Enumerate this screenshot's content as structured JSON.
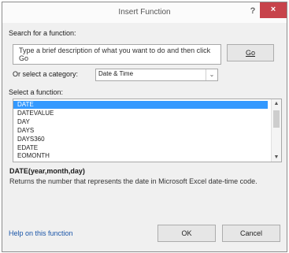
{
  "window": {
    "title": "Insert Function",
    "help_glyph": "?",
    "close_glyph": "×"
  },
  "search": {
    "label": "Search for a function:",
    "value": "Type a brief description of what you want to do and then click Go",
    "go_label": "Go"
  },
  "category": {
    "label": "Or select a category:",
    "selected": "Date & Time",
    "arrow_glyph": "⌄"
  },
  "function_list": {
    "label": "Select a function:",
    "items": [
      "DATE",
      "DATEVALUE",
      "DAY",
      "DAYS",
      "DAYS360",
      "EDATE",
      "EOMONTH"
    ],
    "selected": "DATE",
    "scroll_up": "▲",
    "scroll_down": "▼"
  },
  "details": {
    "syntax": "DATE(year,month,day)",
    "description": "Returns the number that represents the date in Microsoft Excel date-time code."
  },
  "footer": {
    "help_link": "Help on this function",
    "ok_label": "OK",
    "cancel_label": "Cancel"
  },
  "colors": {
    "selection": "#3399ff",
    "close_button": "#c7434b",
    "link": "#1a55a8"
  }
}
